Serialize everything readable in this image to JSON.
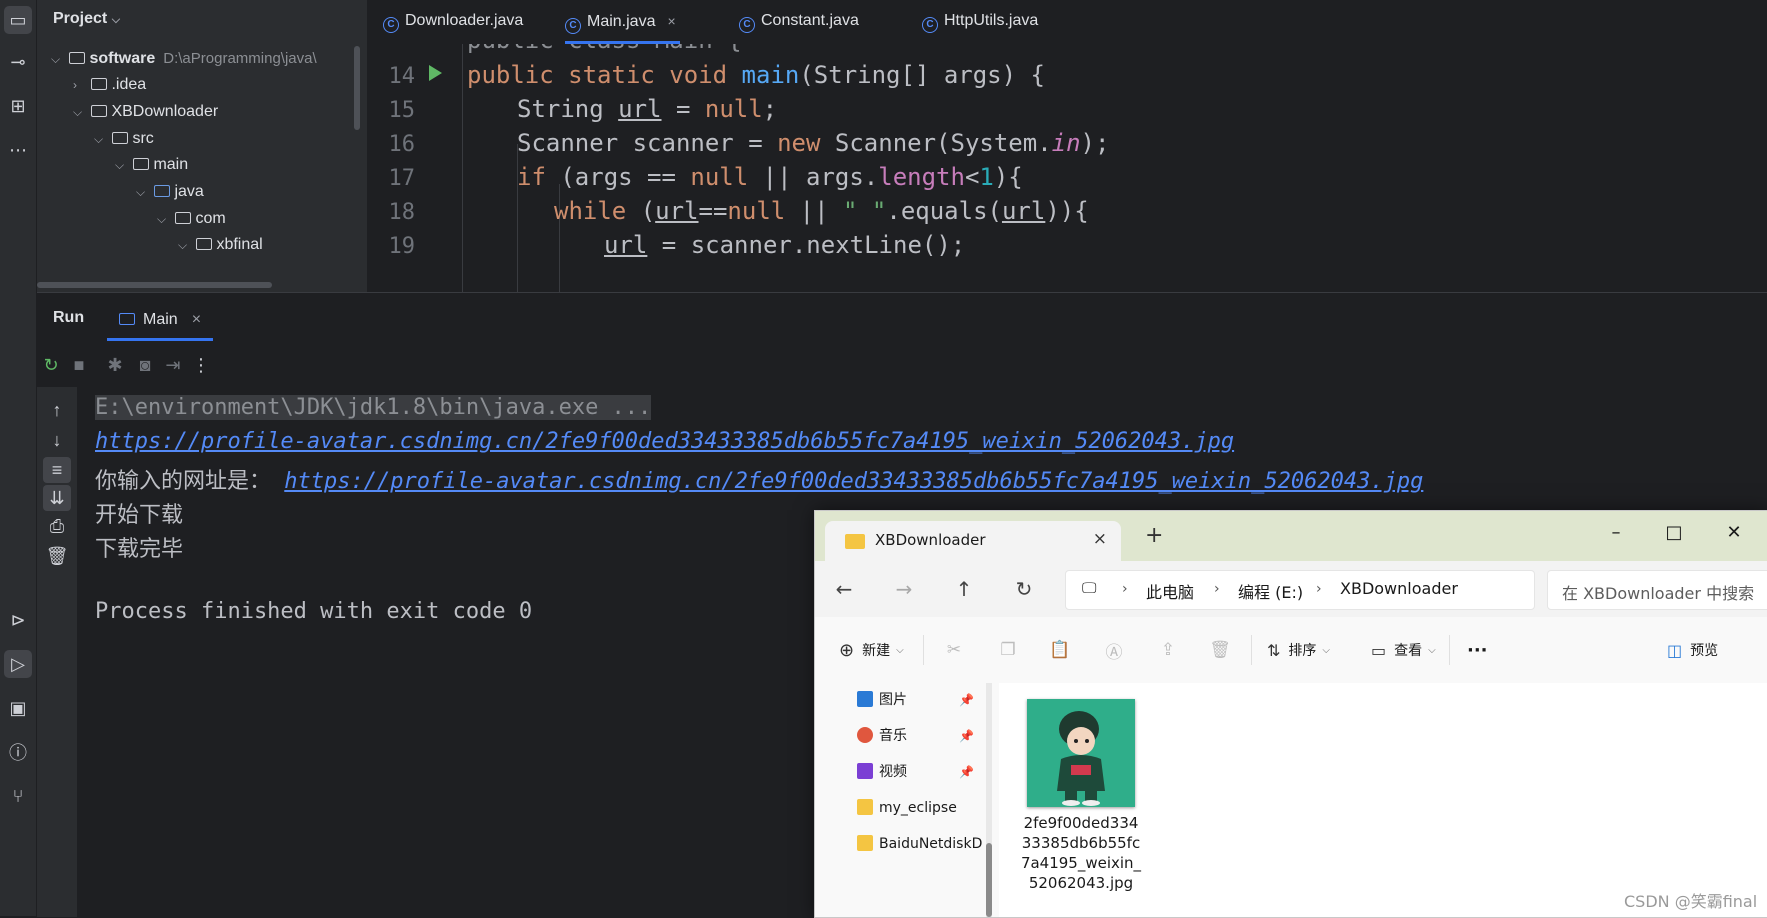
{
  "project_panel": {
    "title": "Project",
    "tree": [
      {
        "label": "software",
        "hint": "D:\\aProgramming\\java\\",
        "chevron": "v"
      },
      {
        "label": ".idea",
        "chevron": ">"
      },
      {
        "label": "XBDownloader",
        "chevron": "v"
      },
      {
        "label": "src",
        "chevron": "v"
      },
      {
        "label": "main",
        "chevron": "v"
      },
      {
        "label": "java",
        "chevron": "v"
      },
      {
        "label": "com",
        "chevron": "v"
      },
      {
        "label": "xbfinal",
        "chevron": "v"
      }
    ]
  },
  "editor": {
    "tabs": [
      {
        "label": "Downloader.java"
      },
      {
        "label": "Main.java",
        "close": "×"
      },
      {
        "label": "Constant.java"
      },
      {
        "label": "HttpUtils.java"
      }
    ],
    "partial_line": "public class Main {",
    "line_numbers": [
      "14",
      "15",
      "16",
      "17",
      "18",
      "19"
    ],
    "lines": {
      "l14": {
        "a": "public static void ",
        "b": "main",
        "c": "(String[] args) {"
      },
      "l15": {
        "a": "String ",
        "b": "url",
        "c": " = ",
        "d": "null",
        "e": ";"
      },
      "l16": {
        "a": "Scanner scanner = ",
        "b": "new",
        "c": " Scanner(System.",
        "d": "in",
        "e": ");"
      },
      "l17": {
        "a": "if",
        "b": " (args == ",
        "c": "null",
        "d": " || args.",
        "e": "length",
        "f": "<",
        "g": "1",
        "h": "){"
      },
      "l18": {
        "a": "while",
        "b": " (",
        "c": "url",
        "d": "==",
        "e": "null",
        "f": " || ",
        "g": "\" \"",
        "h": ".equals(",
        "i": "url",
        "j": ")){"
      },
      "l19": {
        "a": "url",
        "b": " = scanner.nextLine();"
      }
    }
  },
  "run_panel": {
    "title": "Run",
    "tab_label": "Main",
    "tab_close": "×",
    "console": {
      "cmd": "E:\\environment\\JDK\\jdk1.8\\bin\\java.exe ...",
      "url_echo": "https://profile-avatar.csdnimg.cn/2fe9f00ded33433385db6b55fc7a4195_weixin_52062043.jpg",
      "prompt": "你输入的网址是：",
      "url_link": "https://profile-avatar.csdnimg.cn/2fe9f00ded33433385db6b55fc7a4195_weixin_52062043.jpg",
      "start": "开始下载",
      "done": "下载完毕",
      "exit": "Process finished with exit code 0"
    }
  },
  "explorer": {
    "tab_title": "XBDownloader",
    "tab_close": "×",
    "new_tab": "+",
    "window_buttons": {
      "min": "–",
      "max": "□",
      "close": "✕"
    },
    "breadcrumb": [
      "此电脑",
      "编程 (E:)",
      "XBDownloader"
    ],
    "search_placeholder": "在 XBDownloader 中搜索",
    "toolbar": {
      "new": "新建",
      "sort": "排序",
      "view": "查看",
      "more": "···",
      "preview": "预览"
    },
    "sidebar": [
      {
        "label": "图片",
        "pinned": true,
        "color": "#2a7ad5"
      },
      {
        "label": "音乐",
        "pinned": true,
        "color": "#e0573e"
      },
      {
        "label": "视频",
        "pinned": true,
        "color": "#7b3fd4"
      },
      {
        "label": "my_eclipse",
        "pinned": false,
        "color": "#f4c542"
      },
      {
        "label": "BaiduNetdiskD",
        "pinned": false,
        "color": "#f4c542"
      }
    ],
    "file": {
      "name": "2fe9f00ded33433385db6b55fc7a4195_weixin_52062043.jpg"
    }
  },
  "watermark": "CSDN @笑霸final",
  "colors": {
    "accent": "#3574f0",
    "keyword": "#cf8e6d",
    "function": "#56a8f5",
    "link": "#548af7",
    "run_green": "#5fb865"
  }
}
